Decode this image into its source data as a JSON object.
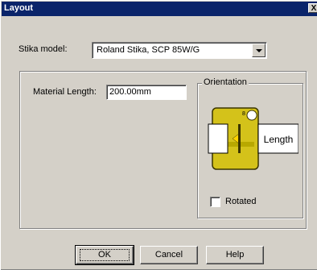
{
  "window": {
    "title": "Layout",
    "close_label": "X"
  },
  "model": {
    "label": "Stika model:",
    "selected": "Roland Stika, SCP 85W/G"
  },
  "material_length": {
    "label": "Material Length:",
    "value": "200.00mm"
  },
  "orientation": {
    "label": "Orientation",
    "length_label": "Length"
  },
  "rotated": {
    "label": "Rotated",
    "checked": false
  },
  "buttons": {
    "ok": "OK",
    "cancel": "Cancel",
    "help": "Help"
  },
  "colors": {
    "device": "#d4c21a",
    "device_dark": "#3a3400",
    "arrow": "#ffd400"
  }
}
